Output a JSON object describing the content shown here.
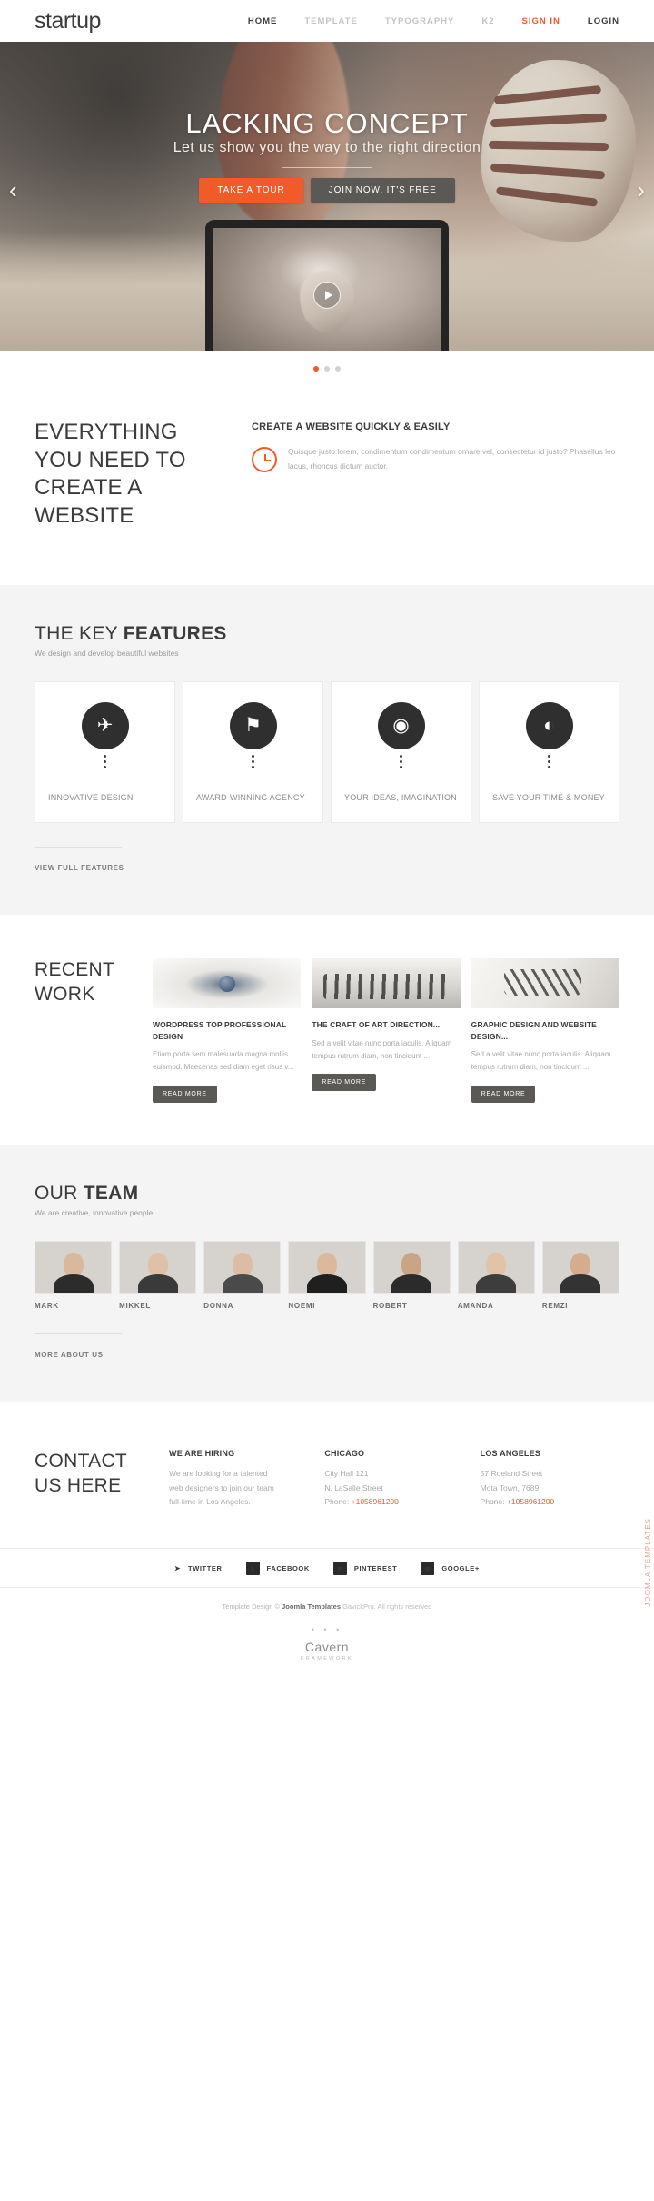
{
  "brand": {
    "name": "startup",
    "accent": "#f15a29"
  },
  "nav": {
    "items": [
      {
        "label": "HOME",
        "state": "active"
      },
      {
        "label": "TEMPLATE",
        "state": "default"
      },
      {
        "label": "TYPOGRAPHY",
        "state": "default"
      },
      {
        "label": "K2",
        "state": "default"
      }
    ],
    "signin": "SIGN IN",
    "login": "LOGIN"
  },
  "hero": {
    "title": "LACKING CONCEPT",
    "subtitle": "Let us show you the way to the right direction",
    "btn_tour": "TAKE A TOUR",
    "btn_join": "JOIN NOW. IT'S FREE",
    "arrow_prev": "‹",
    "arrow_next": "›",
    "slide_count": 3,
    "active_slide": 1
  },
  "everything": {
    "heading": "EVERYTHING YOU NEED TO CREATE A WEBSITE",
    "feature_title": "CREATE A WEBSITE QUICKLY & EASILY",
    "feature_text": "Quisque justo lorem, condimentum condimentum ornare vel, consectetur id justo? Phasellus leo lacus, rhoncus dictum auctor.",
    "icon": "clock-icon"
  },
  "features": {
    "title_light": "THE KEY ",
    "title_bold": "FEATURES",
    "subtitle": "We design and develop beautiful websites",
    "cards": [
      {
        "icon": "rocket-icon",
        "glyph": "✈",
        "label": "INNOVATIVE DESIGN"
      },
      {
        "icon": "medal-icon",
        "glyph": "⚑",
        "label": "AWARD-WINNING AGENCY"
      },
      {
        "icon": "mouse-icon",
        "glyph": "◉",
        "label": "YOUR IDEAS, IMAGINATION"
      },
      {
        "icon": "piggy-bank-icon",
        "glyph": "◐",
        "label": "SAVE YOUR TIME & MONEY"
      }
    ],
    "view_full": "VIEW FULL FEATURES"
  },
  "recent_work": {
    "heading": "RECENT WORK",
    "items": [
      {
        "thumb": "eye-wordpress-thumb",
        "title": "WORDPRESS TOP PROFESSIONAL DESIGN",
        "text": "Etiam porta sem malesuada magna mollis euismod. Maecenas sed diam eget risus v...",
        "button": "READ MORE"
      },
      {
        "thumb": "horses-thumb",
        "title": "THE CRAFT OF ART DIRECTION...",
        "text": "Sed a velit vitae nunc porta iaculis. Aliquam tempus rutrum diam, non tincidunt ...",
        "button": "READ MORE"
      },
      {
        "thumb": "abstract-horse-thumb",
        "title": "GRAPHIC DESIGN AND WEBSITE DESIGN...",
        "text": "Sed a velit vitae nunc porta iaculis. Aliquam tempus rutrum diam, non tincidunt ...",
        "button": "READ MORE"
      }
    ]
  },
  "team": {
    "title_light": "OUR ",
    "title_bold": "TEAM",
    "subtitle": "We are creative, innovative people",
    "members": [
      {
        "name": "MARK",
        "hair": "#3a3330",
        "skin": "#d9b89d",
        "shirt": "#2c2c2c"
      },
      {
        "name": "MIKKEL",
        "hair": "#6d5a45",
        "skin": "#e0c0a6",
        "shirt": "#3a3a3a"
      },
      {
        "name": "DONNA",
        "hair": "#2e2722",
        "skin": "#dcbda4",
        "shirt": "#4a4a4a"
      },
      {
        "name": "NOEMI",
        "hair": "#241e1a",
        "skin": "#dcb99c",
        "shirt": "#1f1f1f"
      },
      {
        "name": "ROBERT",
        "hair": "#2a2320",
        "skin": "#caa486",
        "shirt": "#2b2b2b"
      },
      {
        "name": "AMANDA",
        "hair": "#4a3a2c",
        "skin": "#e2c3a8",
        "shirt": "#3d3d3d"
      },
      {
        "name": "REMZI",
        "hair": "#362d26",
        "skin": "#d3ad8e",
        "shirt": "#333333"
      }
    ],
    "more_about": "MORE ABOUT US"
  },
  "contact": {
    "heading": "CONTACT US HERE",
    "columns": [
      {
        "title": "WE ARE HIRING",
        "lines": [
          "We are looking for a talented",
          "web designers to join our team",
          "full-time in Los Angeles."
        ],
        "phone": ""
      },
      {
        "title": "CHICAGO",
        "lines": [
          "City Hall 121",
          "N. LaSalle Street"
        ],
        "phone_label": "Phone: ",
        "phone": "+1058961200"
      },
      {
        "title": "LOS ANGELES",
        "lines": [
          "57 Roeland Street",
          "Mota Town, 7689"
        ],
        "phone_label": "Phone: ",
        "phone": "+1058961200"
      }
    ]
  },
  "social": [
    {
      "icon": "twitter-icon",
      "glyph": "✈",
      "label": "TWITTER",
      "style": "plain"
    },
    {
      "icon": "facebook-icon",
      "glyph": "f",
      "label": "FACEBOOK",
      "style": "square"
    },
    {
      "icon": "pinterest-icon",
      "glyph": "ᴘ",
      "label": "PINTEREST",
      "style": "square"
    },
    {
      "icon": "google-plus-icon",
      "glyph": "g",
      "label": "GOOGLE+",
      "style": "square"
    }
  ],
  "footer": {
    "copy_prefix": "Template Design © ",
    "copy_bold": "Joomla Templates",
    "copy_suffix": " GavickPro. All rights reserved",
    "dots": "• • •",
    "cavern_name": "Cavern",
    "cavern_sub": "FRAMEWORK",
    "side_tab": "JOOMLA TEMPLATES"
  }
}
